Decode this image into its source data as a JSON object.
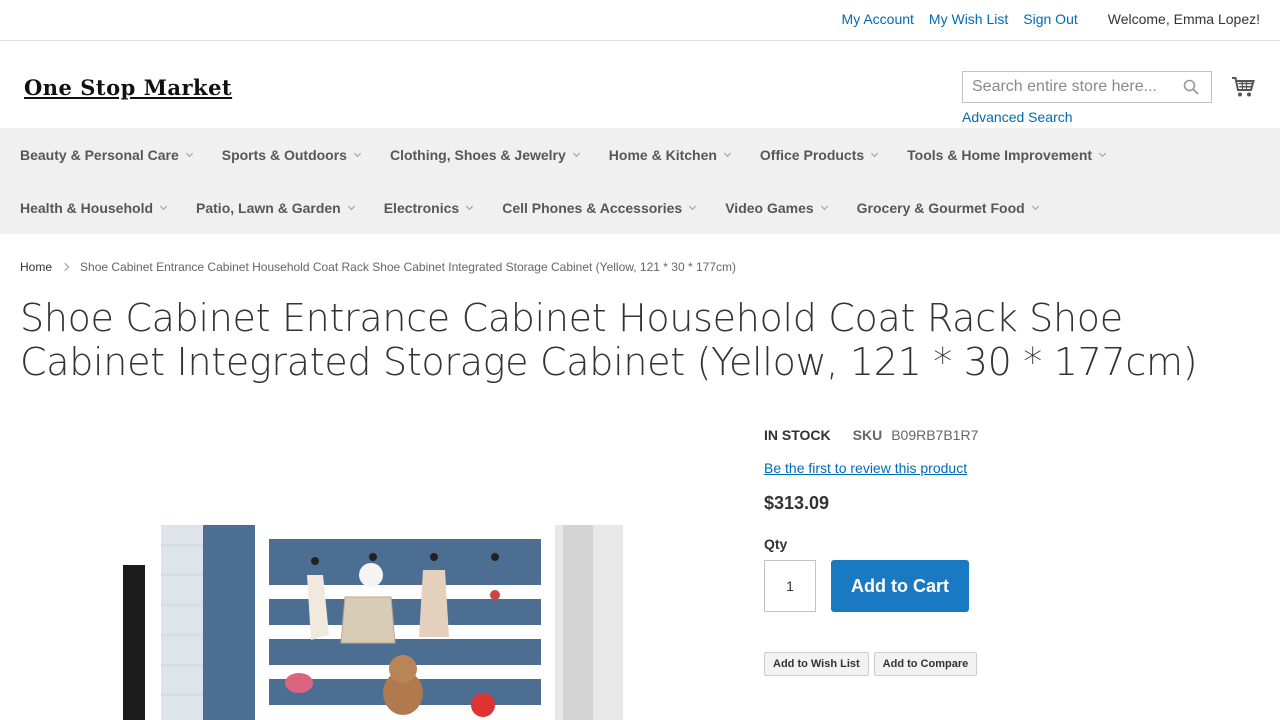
{
  "top_links": {
    "my_account": "My Account",
    "my_wish_list": "My Wish List",
    "sign_out": "Sign Out",
    "welcome": "Welcome, Emma Lopez!"
  },
  "header": {
    "logo": "One Stop Market",
    "search_placeholder": "Search entire store here...",
    "advanced_search": "Advanced Search",
    "search_icon": "search-icon",
    "cart_icon": "cart-icon"
  },
  "nav": {
    "row1": [
      {
        "label": "Beauty & Personal Care"
      },
      {
        "label": "Sports & Outdoors"
      },
      {
        "label": "Clothing, Shoes & Jewelry"
      },
      {
        "label": "Home & Kitchen"
      },
      {
        "label": "Office Products"
      },
      {
        "label": "Tools & Home Improvement"
      }
    ],
    "row2": [
      {
        "label": "Health & Household"
      },
      {
        "label": "Patio, Lawn & Garden"
      },
      {
        "label": "Electronics"
      },
      {
        "label": "Cell Phones & Accessories"
      },
      {
        "label": "Video Games"
      },
      {
        "label": "Grocery & Gourmet Food"
      }
    ]
  },
  "breadcrumb": {
    "home": "Home",
    "current": "Shoe Cabinet Entrance Cabinet Household Coat Rack Shoe Cabinet Integrated Storage Cabinet (Yellow, 121 * 30 * 177cm)"
  },
  "product": {
    "title": "Shoe Cabinet Entrance Cabinet Household Coat Rack Shoe Cabinet Integrated Storage Cabinet (Yellow, 121 * 30 * 177cm)",
    "stock": "IN STOCK",
    "sku_label": "SKU",
    "sku": "B09RB7B1R7",
    "review_link": "Be the first to review this product",
    "price": "$313.09",
    "qty_label": "Qty",
    "qty_value": "1",
    "add_to_cart": "Add to Cart",
    "add_to_wishlist": "Add to Wish List",
    "add_to_compare": "Add to Compare"
  },
  "colors": {
    "link": "#006bb4",
    "primary_button": "#1979c3",
    "nav_background": "#f0f0f0"
  }
}
